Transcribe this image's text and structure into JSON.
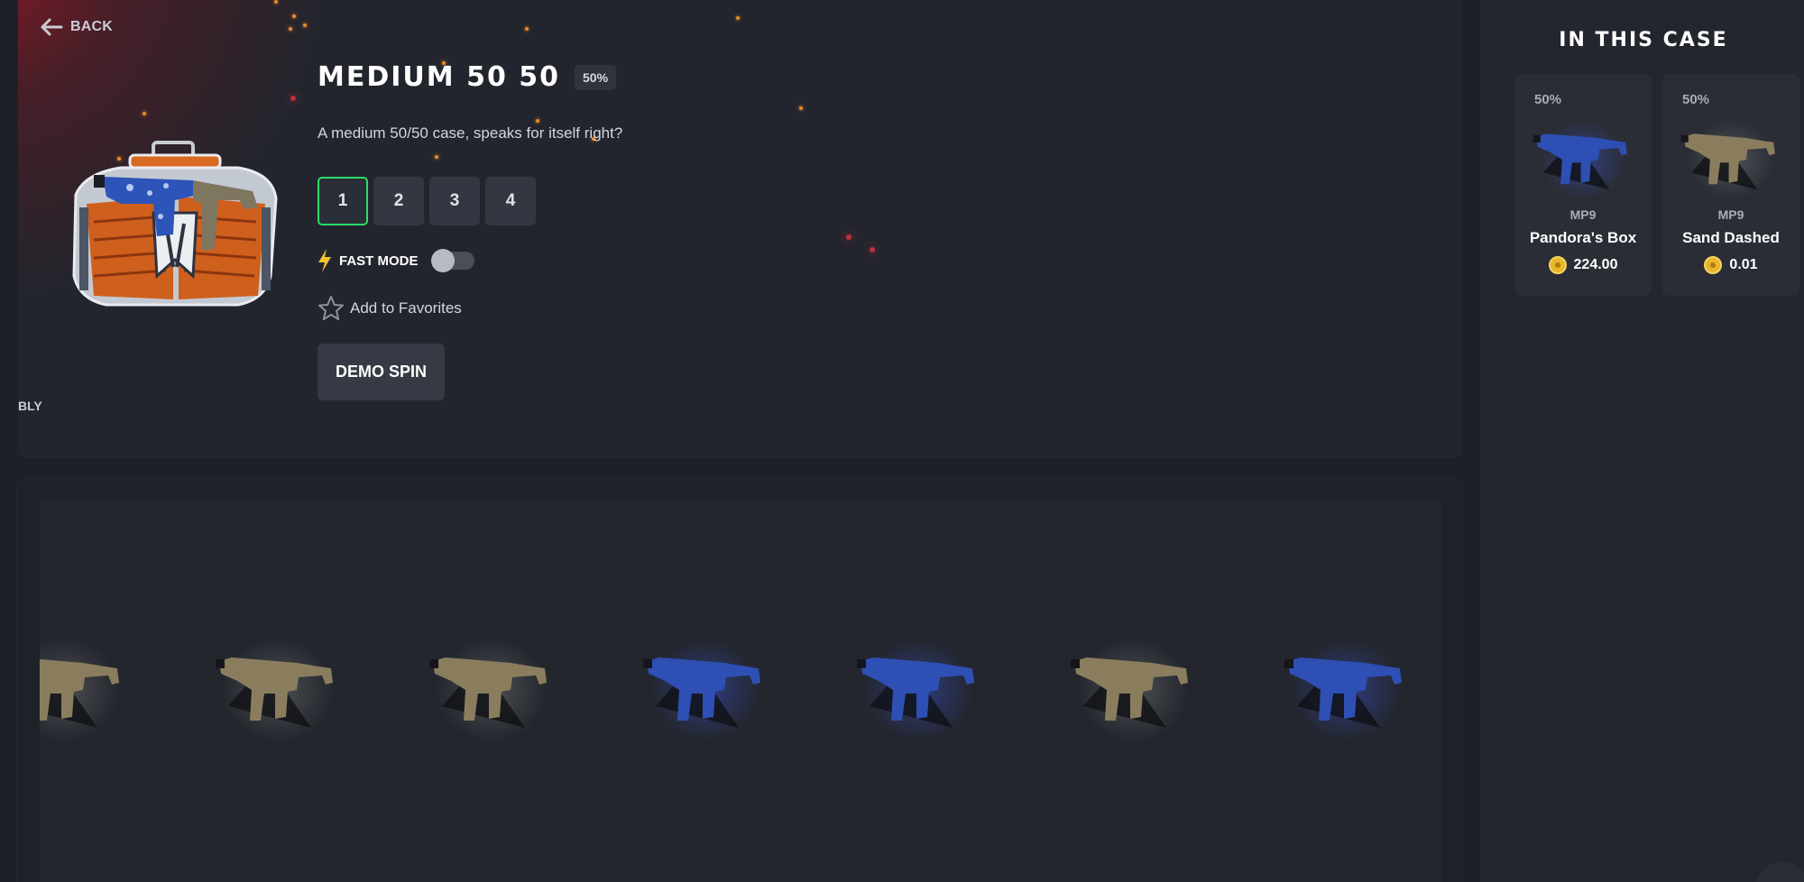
{
  "header": {
    "back_label": "BACK",
    "title": "MEDIUM 50 50",
    "odds_badge": "50%",
    "description": "A medium 50/50 case, speaks for itself right?",
    "side_fragment": "BLY"
  },
  "quantity": {
    "options": [
      "1",
      "2",
      "3",
      "4"
    ],
    "selected": "1"
  },
  "fast_mode": {
    "label": "FAST MODE",
    "enabled": false
  },
  "favorites": {
    "label": "Add to Favorites"
  },
  "demo_spin": {
    "label": "DEMO SPIN"
  },
  "sidebar": {
    "title": "IN THIS CASE",
    "items": [
      {
        "odds": "50%",
        "weapon": "MP9",
        "name": "Pandora's Box",
        "price": "224.00",
        "skin": "blue"
      },
      {
        "odds": "50%",
        "weapon": "MP9",
        "name": "Sand Dashed",
        "price": "0.01",
        "skin": "tan"
      }
    ]
  },
  "reel": {
    "items": [
      "tan",
      "tan",
      "tan",
      "blue",
      "blue",
      "tan",
      "blue"
    ]
  },
  "colors": {
    "accent_green": "#2ddb6a",
    "coin_gold": "#e8b52b",
    "skin_blue": "#2e4fb3",
    "skin_tan": "#8a7d5e",
    "glow_red": "#961826"
  }
}
